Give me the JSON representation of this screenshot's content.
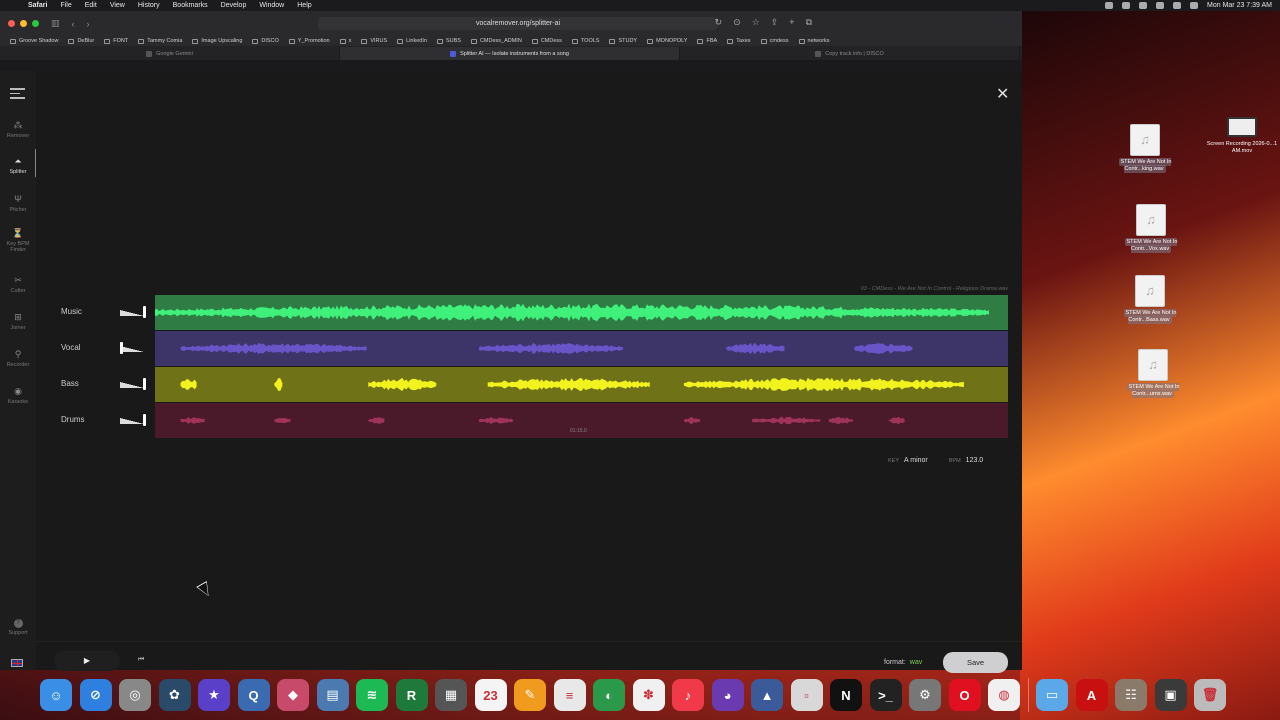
{
  "menubar": {
    "app": "Safari",
    "items": [
      "File",
      "Edit",
      "View",
      "History",
      "Bookmarks",
      "Develop",
      "Window",
      "Help"
    ],
    "clock": "Mon Mar 23  7:39 AM"
  },
  "browser": {
    "url": "vocalremover.org/splitter-ai",
    "bookmarks": [
      "Groove Shadow",
      "DeBlur",
      "FONT",
      "Tammy Comia",
      "Image Upscaling",
      "DISCO",
      "Y_Promotion",
      "x",
      "VIRUS",
      "LinkedIn",
      "SUBS",
      "CMDess_ADMIN",
      "CMDess",
      "TOOLS",
      "STUDY",
      "MONOPOLY",
      "FBA",
      "Taxes",
      "cmdess",
      "networks"
    ],
    "tabs": [
      {
        "title": "Google Gemini",
        "active": false
      },
      {
        "title": "Splitter AI — Isolate instruments from a song",
        "active": true
      },
      {
        "title": "Copy track info | DISCO",
        "active": false
      }
    ]
  },
  "sidebar": {
    "items": [
      {
        "label": "Remover",
        "icon": "remover-icon",
        "glyph": "⁂",
        "active": false
      },
      {
        "label": "Splitter",
        "icon": "splitter-icon",
        "glyph": "⏶",
        "active": true
      },
      {
        "label": "Pitcher",
        "icon": "tuning-fork-icon",
        "glyph": "Ψ",
        "active": false
      },
      {
        "label": "Key BPM Finder",
        "icon": "metronome-icon",
        "glyph": "⏳",
        "active": false
      },
      {
        "label": "Cutter",
        "icon": "scissors-icon",
        "glyph": "✂",
        "active": false
      },
      {
        "label": "Joiner",
        "icon": "joiner-icon",
        "glyph": "⊞",
        "active": false
      },
      {
        "label": "Recorder",
        "icon": "microphone-icon",
        "glyph": "⚲",
        "active": false
      },
      {
        "label": "Karaoke",
        "icon": "karaoke-icon",
        "glyph": "◉",
        "active": false
      }
    ],
    "support": "Support",
    "language_icon": "uk-flag-icon"
  },
  "player": {
    "file_name": "03 - CMDess - We Are Not In Control - Religious Drama.wav",
    "timecode": "01:15.0",
    "key_label": "KEY",
    "key_value": "A minor",
    "bpm_label": "BPM",
    "bpm_value": "123.0",
    "tracks": [
      {
        "name": "Music",
        "volume": 1.0,
        "bg": "#2f7d45",
        "wave": "#3ff07a"
      },
      {
        "name": "Vocal",
        "volume": 0.0,
        "bg": "#3d3468",
        "wave": "#6a55c8"
      },
      {
        "name": "Bass",
        "volume": 1.0,
        "bg": "#6f7216",
        "wave": "#f2f21e"
      },
      {
        "name": "Drums",
        "volume": 1.0,
        "bg": "#4a1a2a",
        "wave": "#a0335a"
      }
    ],
    "format_label": "format:",
    "format_value": "wav",
    "save_label": "Save"
  },
  "desktop": {
    "files": [
      {
        "name": "STEM We Are Not In Contr...king.wav"
      },
      {
        "name": "STEM We Are Not In Contr...Vox.wav"
      },
      {
        "name": "STEM We Are Not In Contr...Bass.wav"
      },
      {
        "name": "STEM We Are Not In Contr...urns.wav"
      },
      {
        "name": "Screen Recording 2026-0...1 AM.mov"
      }
    ]
  },
  "dock": {
    "apps": [
      {
        "name": "finder-icon",
        "color": "#3a8ee6",
        "glyph": "☺"
      },
      {
        "name": "safari-icon",
        "color": "#2f7fe0",
        "glyph": "⊘"
      },
      {
        "name": "launchpad-icon",
        "color": "#888888",
        "glyph": "◎"
      },
      {
        "name": "davinci-resolve-icon",
        "color": "#2a4a6a",
        "glyph": "✿"
      },
      {
        "name": "imovie-icon",
        "color": "#5a3fc8",
        "glyph": "★"
      },
      {
        "name": "quicktime-icon",
        "color": "#3a6ab0",
        "glyph": "Q"
      },
      {
        "name": "affinity-icon",
        "color": "#c84a6a",
        "glyph": "◆"
      },
      {
        "name": "preview-icon",
        "color": "#4a7ab0",
        "glyph": "▤"
      },
      {
        "name": "spotify-icon",
        "color": "#1db954",
        "glyph": "≋"
      },
      {
        "name": "fl-reaper-icon",
        "color": "#1e7a3a",
        "glyph": "R"
      },
      {
        "name": "calculator-icon",
        "color": "#555555",
        "glyph": "▦"
      },
      {
        "name": "calendar-icon",
        "color": "#f4f4f4",
        "glyph": "23"
      },
      {
        "name": "pages-icon",
        "color": "#f09a1e",
        "glyph": "✎"
      },
      {
        "name": "textedit-icon",
        "color": "#e8e8e8",
        "glyph": "≡"
      },
      {
        "name": "gpu-icon",
        "color": "#2a9a4a",
        "glyph": "◐"
      },
      {
        "name": "photos-icon",
        "color": "#f0f0f0",
        "glyph": "✽"
      },
      {
        "name": "music-icon",
        "color": "#f03a4a",
        "glyph": "♪"
      },
      {
        "name": "firefox-icon",
        "color": "#6a3ab0",
        "glyph": "◕"
      },
      {
        "name": "logic-icon",
        "color": "#3a5a9a",
        "glyph": "▲"
      },
      {
        "name": "blank-app-icon",
        "color": "#d8d8d8",
        "glyph": "▫"
      },
      {
        "name": "native-instruments-icon",
        "color": "#111111",
        "glyph": "N"
      },
      {
        "name": "terminal-icon",
        "color": "#222222",
        "glyph": ">_"
      },
      {
        "name": "system-settings-icon",
        "color": "#777777",
        "glyph": "⚙"
      },
      {
        "name": "opera-icon",
        "color": "#e01020",
        "glyph": "O"
      },
      {
        "name": "chrome-icon",
        "color": "#f0f0f0",
        "glyph": "◍"
      },
      {
        "name": "downloads-folder-icon",
        "color": "#5aa8e8",
        "glyph": "▭"
      },
      {
        "name": "acrobat-icon",
        "color": "#c81010",
        "glyph": "A"
      },
      {
        "name": "mixer-icon",
        "color": "#8a7a6a",
        "glyph": "☷"
      },
      {
        "name": "stacks-icon",
        "color": "#3a3a3a",
        "glyph": "▣"
      },
      {
        "name": "trash-icon",
        "color": "#bbbbbb",
        "glyph": "🗑"
      }
    ]
  }
}
